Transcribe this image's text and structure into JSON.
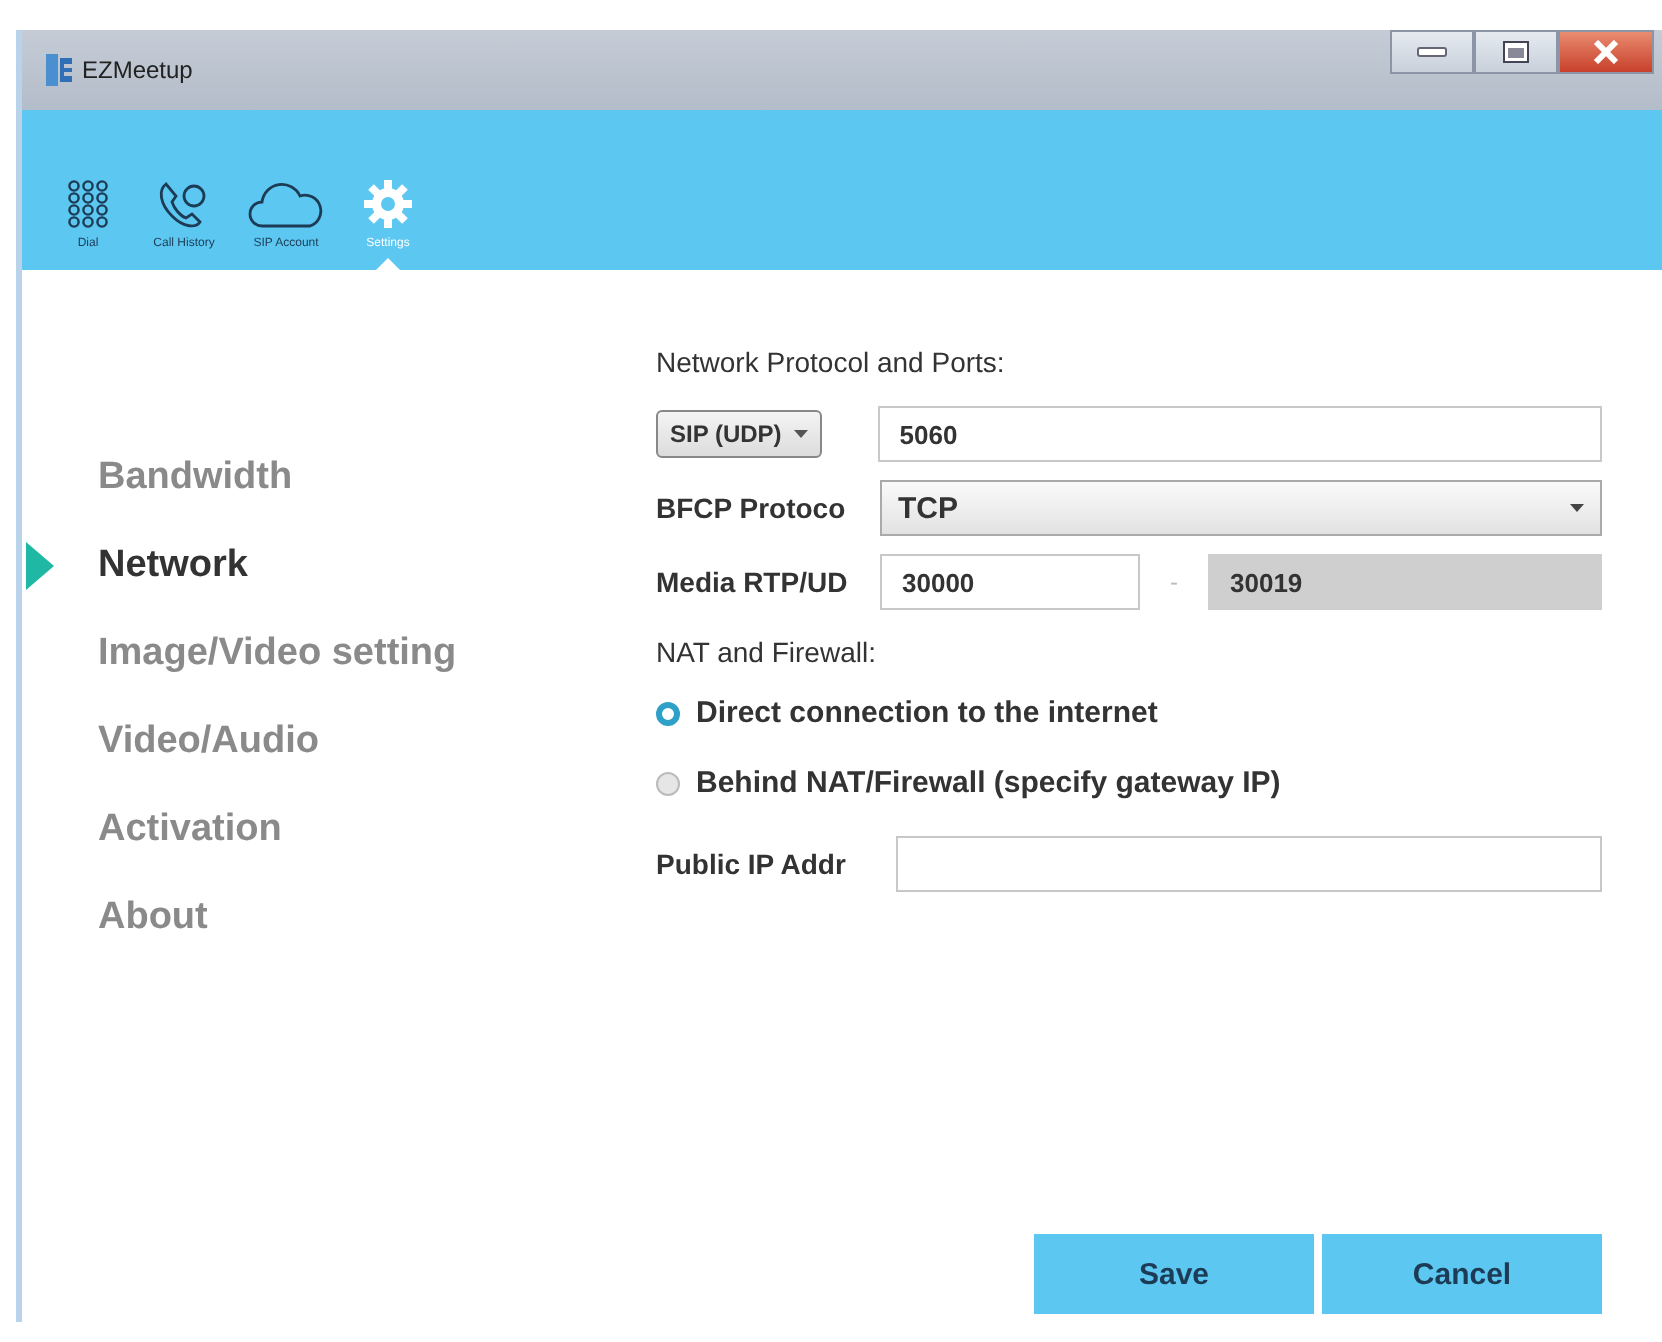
{
  "window": {
    "title": "EZMeetup"
  },
  "toolbar": [
    {
      "label": "Dial",
      "kind": "dial",
      "selected": false
    },
    {
      "label": "Call History",
      "kind": "history",
      "selected": false
    },
    {
      "label": "SIP Account",
      "kind": "cloud",
      "selected": false
    },
    {
      "label": "Settings",
      "kind": "gear",
      "selected": true
    }
  ],
  "sidebar": {
    "items": [
      {
        "label": "Bandwidth",
        "selected": false
      },
      {
        "label": "Network",
        "selected": true
      },
      {
        "label": "Image/Video setting",
        "selected": false
      },
      {
        "label": "Video/Audio",
        "selected": false
      },
      {
        "label": "Activation",
        "selected": false
      },
      {
        "label": "About",
        "selected": false
      }
    ]
  },
  "network": {
    "section_title": "Network Protocol and Ports:",
    "protocol": {
      "value": "SIP (UDP)"
    },
    "port": {
      "value": "5060"
    },
    "bfcp": {
      "label": "BFCP Protoco",
      "value": "TCP"
    },
    "media": {
      "label": "Media RTP/UD",
      "from": "30000",
      "separator": "-",
      "to": "30019"
    },
    "nat_title": "NAT and Firewall:",
    "nat_options": [
      {
        "label": "Direct connection to the internet",
        "selected": true
      },
      {
        "label": "Behind NAT/Firewall (specify gateway IP)",
        "selected": false
      }
    ],
    "public_ip": {
      "label": "Public IP Addr"
    }
  },
  "buttons": [
    "Save",
    "Cancel"
  ]
}
